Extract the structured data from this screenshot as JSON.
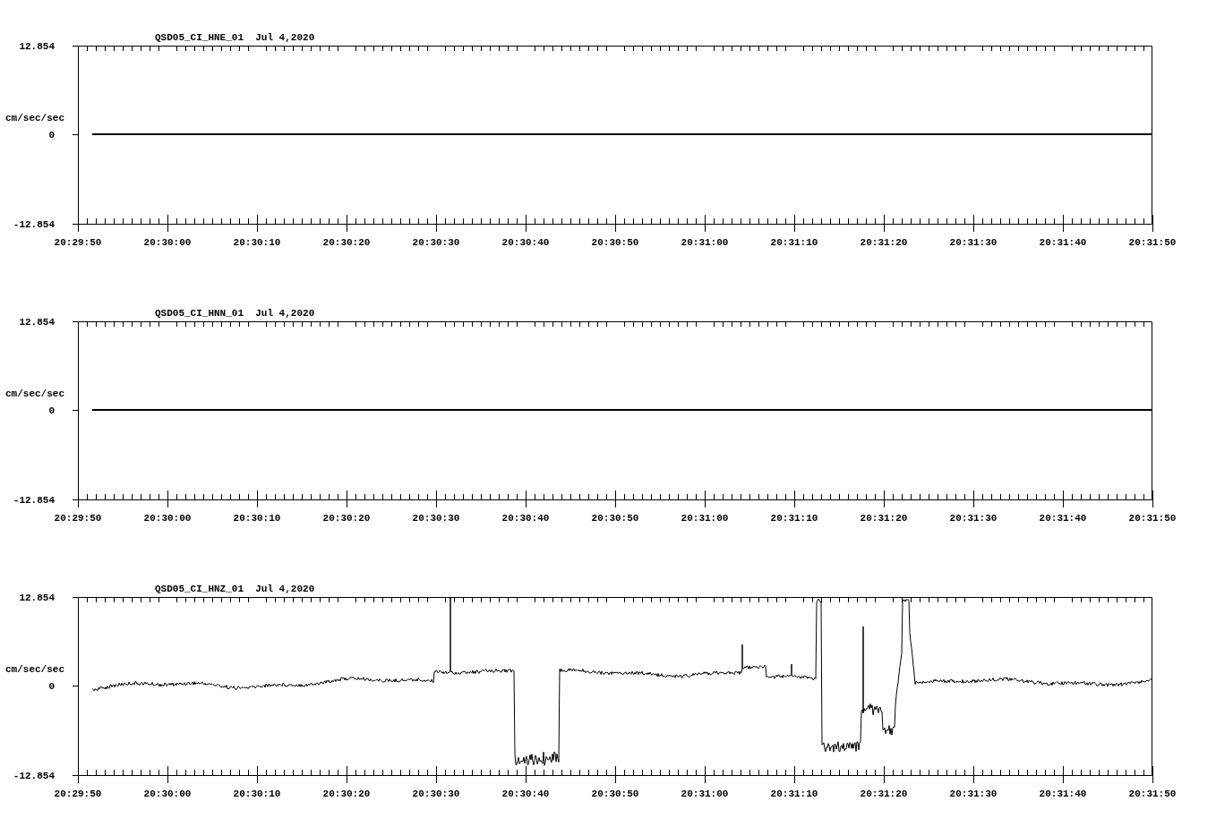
{
  "panels": [
    {
      "title": "QSD05_CI_HNE_01  Jul 4,2020",
      "ylabel": "cm/sec/sec",
      "kind": "flat",
      "yticks": [
        "12.854",
        "0",
        "-12.854"
      ],
      "xticks": [
        "20:29:50",
        "20:30:00",
        "20:30:10",
        "20:30:20",
        "20:30:30",
        "20:30:40",
        "20:30:50",
        "20:31:00",
        "20:31:10",
        "20:31:20",
        "20:31:30",
        "20:31:40",
        "20:31:50"
      ]
    },
    {
      "title": "QSD05_CI_HNN_01  Jul 4,2020",
      "ylabel": "cm/sec/sec",
      "kind": "flat",
      "yticks": [
        "12.854",
        "0",
        "-12.854"
      ],
      "xticks": [
        "20:29:50",
        "20:30:00",
        "20:30:10",
        "20:30:20",
        "20:30:30",
        "20:30:40",
        "20:30:50",
        "20:31:00",
        "20:31:10",
        "20:31:20",
        "20:31:30",
        "20:31:40",
        "20:31:50"
      ]
    },
    {
      "title": "QSD05_CI_HNZ_01  Jul 4,2020",
      "ylabel": "cm/sec/sec",
      "kind": "waveform",
      "yticks": [
        "12.854",
        "0",
        "-12.854"
      ],
      "xticks": [
        "20:29:50",
        "20:30:00",
        "20:30:10",
        "20:30:20",
        "20:30:30",
        "20:30:40",
        "20:30:50",
        "20:31:00",
        "20:31:10",
        "20:31:20",
        "20:31:30",
        "20:31:40",
        "20:31:50"
      ]
    }
  ]
}
